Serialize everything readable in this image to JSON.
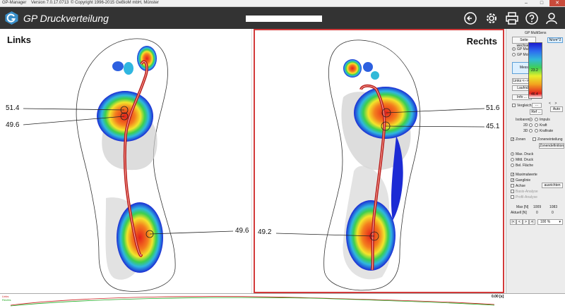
{
  "window": {
    "app": "GP-Manager",
    "version": "Version 7.0.17.0713",
    "copyright": "© Copyright 1996-2015",
    "company": "GeBioM mbH, Münster"
  },
  "app": {
    "title": "GP Druckverteilung"
  },
  "left_panel": {
    "label": "Links",
    "values": [
      "51.4",
      "49.6",
      "49.6"
    ]
  },
  "right_panel": {
    "label": "Rechts",
    "values": [
      "51.6",
      "45.1",
      "49.2"
    ]
  },
  "sidebar": {
    "header": "GP MultiSens",
    "unit": "N/cm^2",
    "scale_values": [
      "23.2",
      "46.4"
    ],
    "seite_wechseln": "Seite wechseln",
    "source_options": [
      "GP MultiSens",
      "GP MobilData"
    ],
    "messung": "Messung",
    "links_rechts": "Links <--> Rechts",
    "laufrichtung": "Laufrichtung",
    "info": "Info ...",
    "vergleich": "Vergleich",
    "ref": "Ref ...",
    "auto": "Auto",
    "isobaren": "Isobaren",
    "impuls": "Impuls",
    "kraft": "Kraft",
    "kraftrate": "Kraftrate",
    "dim_2d": "2D",
    "dim_3d": "3D",
    "zonen": "Zonen",
    "zoneneinteilung": "Zoneneinteilung",
    "zonendefinition": "Zonendefinition",
    "pressure_options": [
      "Max. Druck",
      "Mittl. Druck",
      "Bel. Fläche"
    ],
    "maximalwerte": "Maximalwerte",
    "ganglinie": "Ganglinie",
    "achse": "Achse",
    "ausrichten": "ausrichten",
    "basis_analyse": "Basis-Analyse",
    "profil_analyse": "Profil-Analyse",
    "max_label": "Max [N]",
    "aktuell_label": "Aktuell [N]",
    "max_values": [
      "1009",
      "1083"
    ],
    "aktuell_values": [
      "0",
      "0"
    ],
    "nav": [
      "|<",
      "<",
      ">",
      ">|"
    ],
    "zoom": "100 %"
  },
  "status": {
    "links": "Links",
    "rechts": "Rechts",
    "time": "0.00 [s]"
  }
}
